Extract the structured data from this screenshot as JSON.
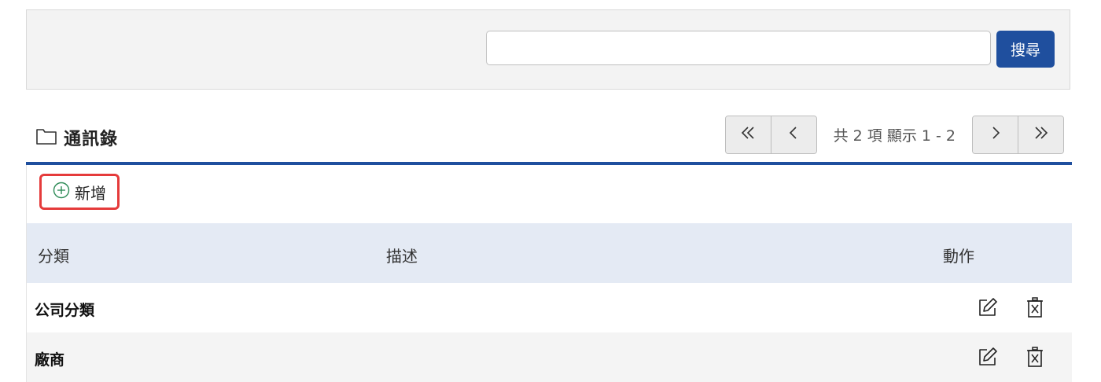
{
  "search": {
    "value": "",
    "placeholder": "",
    "button_label": "搜尋"
  },
  "header": {
    "title": "通訊錄",
    "icon": "folder-icon"
  },
  "pager": {
    "info": "共 2 項 顯示 1 - 2",
    "icons": [
      "double-chevron-left-icon",
      "chevron-left-icon",
      "chevron-right-icon",
      "double-chevron-right-icon"
    ]
  },
  "toolbar": {
    "add_label": "新增",
    "add_icon": "plus-circle-icon"
  },
  "table": {
    "columns": [
      "分類",
      "描述",
      "動作"
    ],
    "rows": [
      {
        "category": "公司分類",
        "description": ""
      },
      {
        "category": "廠商",
        "description": ""
      }
    ],
    "action_icons": [
      "edit-icon",
      "delete-icon"
    ]
  },
  "colors": {
    "accent": "#1f4f9e",
    "highlight_border": "#e53b3b",
    "add_icon": "#2e8b57",
    "header_row": "#e4eaf4",
    "panel": "#f3f3f3"
  }
}
